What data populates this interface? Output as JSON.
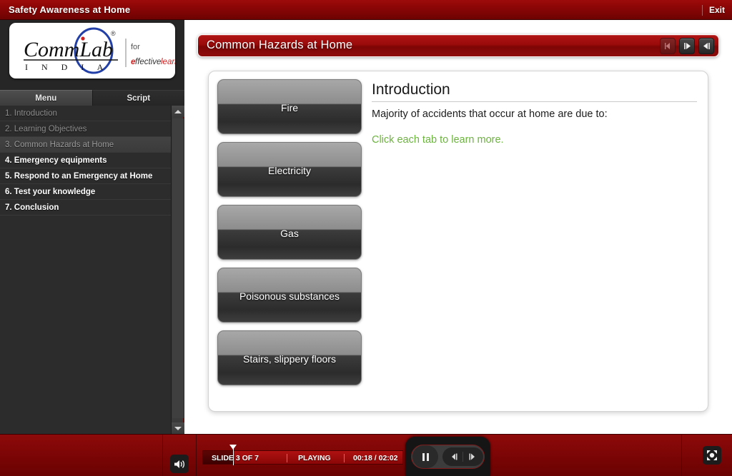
{
  "topbar": {
    "course_title": "Safety Awareness at Home",
    "exit_label": "Exit"
  },
  "logo": {
    "brand_main": "CommLab",
    "brand_sub": "I  N  D  I  A",
    "registered_mark": "®",
    "tagline_line1": "for",
    "tagline_line2_accent": "e",
    "tagline_line2_italic": "ffective",
    "tagline_line2_red": " learning"
  },
  "sidebar": {
    "tabs": [
      {
        "label": "Menu",
        "active": true
      },
      {
        "label": "Script",
        "active": false
      }
    ],
    "items": [
      {
        "label": "1. Introduction",
        "state": "visited"
      },
      {
        "label": "2. Learning Objectives",
        "state": "visited"
      },
      {
        "label": "3. Common Hazards at Home",
        "state": "current"
      },
      {
        "label": "4. Emergency equipments",
        "state": "upcoming"
      },
      {
        "label": "5. Respond to an Emergency at Home",
        "state": "upcoming"
      },
      {
        "label": "6. Test your knowledge",
        "state": "upcoming"
      },
      {
        "label": "7. Conclusion",
        "state": "upcoming"
      }
    ],
    "scroll_up_icon": "triangle-up-icon",
    "scroll_down_icon": "triangle-down-icon"
  },
  "slide": {
    "title": "Common Hazards at Home",
    "nav_buttons": [
      {
        "name": "previous-slide-button",
        "icon": "arrow-left-icon",
        "enabled": false
      },
      {
        "name": "next-slide-button",
        "icon": "arrow-right-icon",
        "enabled": true
      },
      {
        "name": "back-slide-button",
        "icon": "arrow-left-bar-icon",
        "enabled": true
      }
    ]
  },
  "hazard_tabs": [
    {
      "label": "Fire"
    },
    {
      "label": "Electricity"
    },
    {
      "label": "Gas"
    },
    {
      "label": "Poisonous substances"
    },
    {
      "label": "Stairs, slippery floors"
    }
  ],
  "content": {
    "heading": "Introduction",
    "body": "Majority of accidents that occur at home are due to:",
    "hint": "Click each tab to learn more.",
    "hint_color": "#6cb33f"
  },
  "player": {
    "volume_icon": "speaker-icon",
    "slide_counter": "SLIDE 3 OF 7",
    "status": "PLAYING",
    "time": "00:18 / 02:02",
    "progress_percent": 15,
    "pause_icon": "pause-icon",
    "prev_icon": "step-backward-icon",
    "next_icon": "step-forward-icon",
    "fullscreen_icon": "fullscreen-icon"
  },
  "colors": {
    "brand_red": "#8d0606",
    "title_red": "#9a0b0b",
    "sidebar_dark": "#2c2c2c",
    "hint_green": "#6cb33f"
  }
}
